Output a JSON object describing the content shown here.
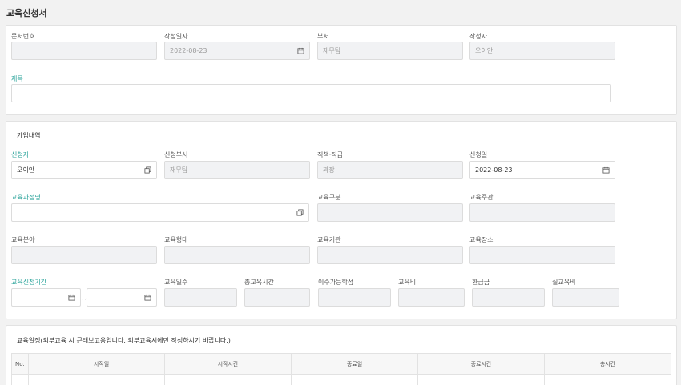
{
  "page": {
    "title": "교육신청서"
  },
  "doc": {
    "doc_no": {
      "label": "문서번호",
      "value": ""
    },
    "write_date": {
      "label": "작성일자",
      "value": "2022-08-23"
    },
    "dept": {
      "label": "부서",
      "value": "재무팀"
    },
    "writer": {
      "label": "작성자",
      "value": "오이안"
    },
    "subject": {
      "label": "제목",
      "value": ""
    }
  },
  "join": {
    "section_title": "가입내역",
    "applicant": {
      "label": "신청자",
      "value": "오이안"
    },
    "apply_dept": {
      "label": "신청부서",
      "value": "재무팀"
    },
    "position": {
      "label": "직책·직급",
      "value": "과장"
    },
    "apply_date": {
      "label": "신청일",
      "value": "2022-08-23"
    },
    "course_name": {
      "label": "교육과정명",
      "value": ""
    },
    "edu_type": {
      "label": "교육구분",
      "value": ""
    },
    "edu_host": {
      "label": "교육주관",
      "value": ""
    },
    "edu_field": {
      "label": "교육분야",
      "value": ""
    },
    "edu_form": {
      "label": "교육형태",
      "value": ""
    },
    "edu_org": {
      "label": "교육기관",
      "value": ""
    },
    "edu_place": {
      "label": "교육장소",
      "value": ""
    },
    "period": {
      "label": "교육신청기간",
      "start": "",
      "end": "",
      "separator": "~"
    },
    "edu_days": {
      "label": "교육일수",
      "value": ""
    },
    "total_hours": {
      "label": "총교육시간",
      "value": ""
    },
    "credits": {
      "label": "이수가능학점",
      "value": ""
    },
    "cost": {
      "label": "교육비",
      "value": ""
    },
    "refund": {
      "label": "환급금",
      "value": ""
    },
    "actual_cost": {
      "label": "실교육비",
      "value": ""
    }
  },
  "schedule": {
    "section_title": "교육일정(외부교육 시 근태보고용입니다. 외부교육시에만 작성하시기 바랍니다.)",
    "columns": [
      "No.",
      "",
      "시작일",
      "시작시간",
      "종료일",
      "종료시간",
      "총시간"
    ]
  },
  "icons": {
    "calendar": "calendar-icon",
    "copy": "copy-icon"
  },
  "colors": {
    "required_label": "#2aa39a",
    "readonly_bg": "#f1f2f4"
  }
}
